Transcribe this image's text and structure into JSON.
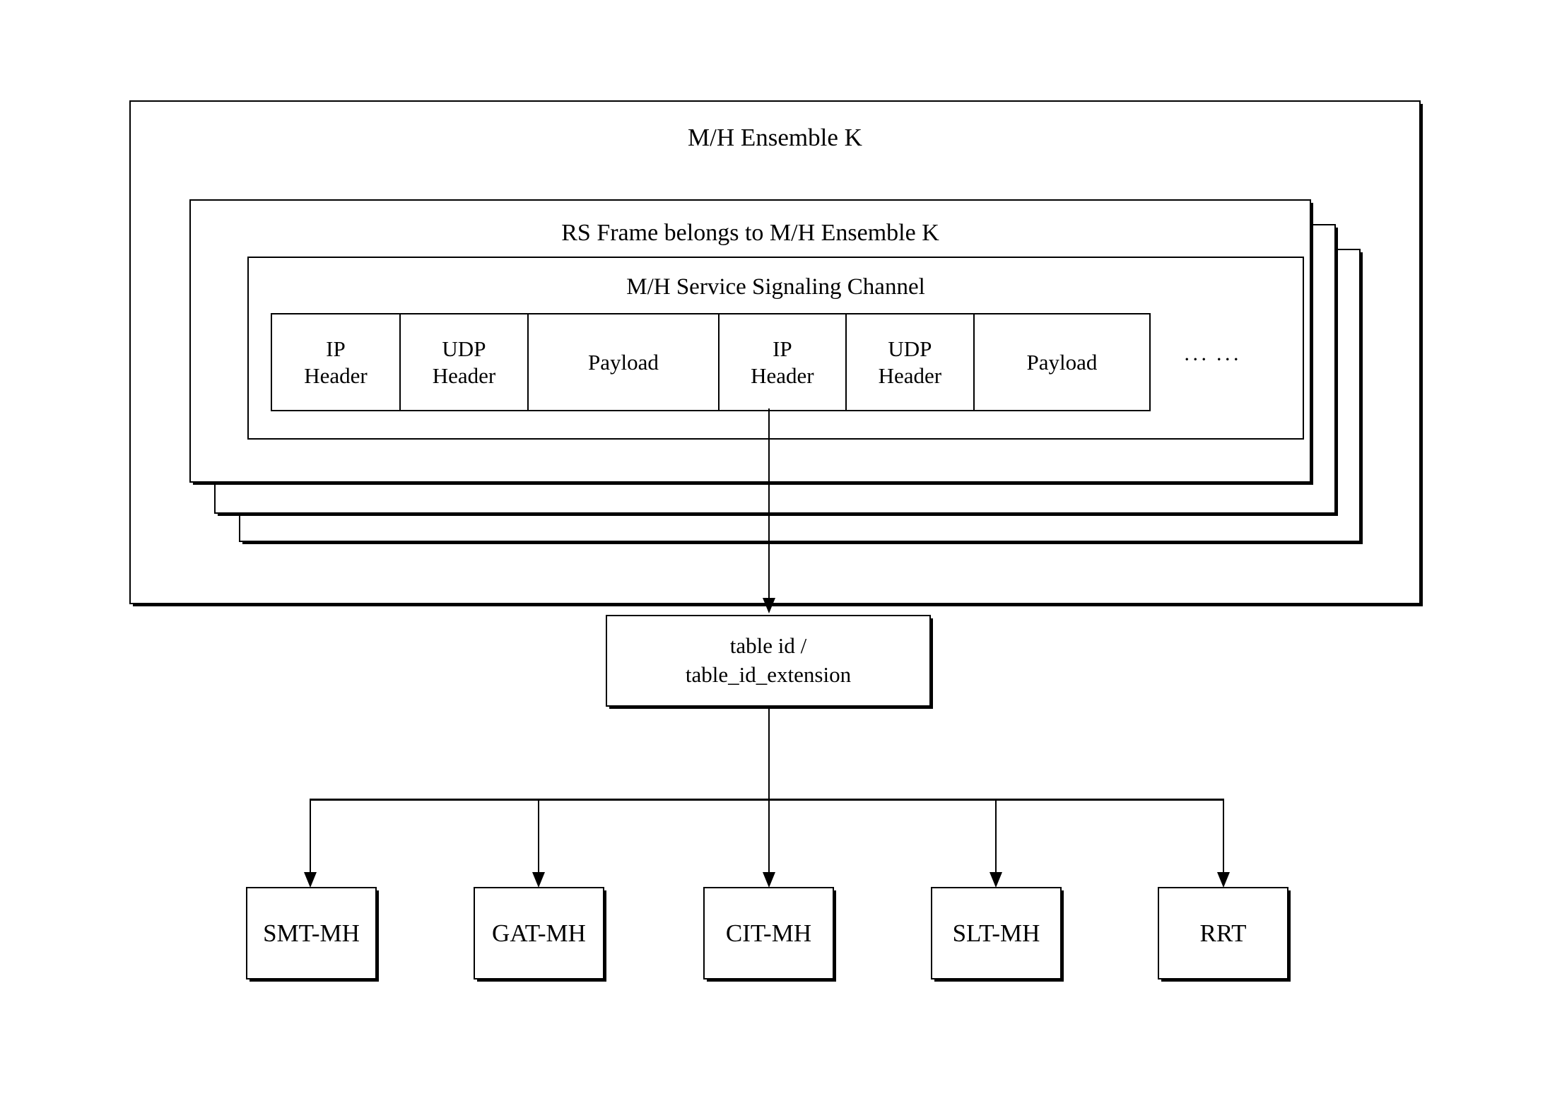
{
  "diagram": {
    "ensemble": {
      "title": "M/H Ensemble K"
    },
    "rs_frame": {
      "title": "RS Frame belongs to M/H Ensemble K",
      "stack_count": 3
    },
    "signaling_channel": {
      "title": "M/H Service Signaling Channel"
    },
    "packet_cells": [
      {
        "line1": "IP",
        "line2": "Header"
      },
      {
        "line1": "UDP",
        "line2": "Header"
      },
      {
        "line1": "Payload",
        "line2": ""
      },
      {
        "line1": "IP",
        "line2": "Header"
      },
      {
        "line1": "UDP",
        "line2": "Header"
      },
      {
        "line1": "Payload",
        "line2": ""
      }
    ],
    "packet_ellipsis": "···  ···",
    "table_id_box": {
      "line1": "table id /",
      "line2": "table_id_extension"
    },
    "tables": [
      {
        "label": "SMT-MH"
      },
      {
        "label": "GAT-MH"
      },
      {
        "label": "CIT-MH"
      },
      {
        "label": "SLT-MH"
      },
      {
        "label": "RRT"
      }
    ],
    "colors": {
      "stroke": "#000000",
      "background": "#ffffff"
    }
  }
}
